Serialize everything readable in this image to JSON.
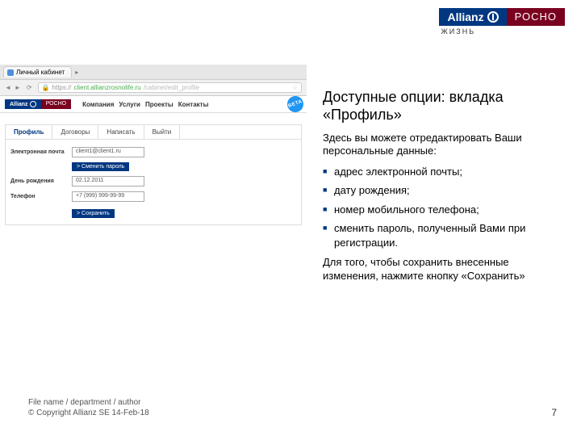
{
  "brand": {
    "allianz": "Allianz",
    "rosno": "РОСНО",
    "sub": "жизнь"
  },
  "browser": {
    "tab_title": "Личный кабинет",
    "url_host": "client.allianzrosnolife.ru",
    "url_path": "/cabinet/edit_profile"
  },
  "site": {
    "nav": [
      "Компания",
      "Услуги",
      "Проекты",
      "Контакты"
    ],
    "beta": "BETA",
    "tabs": [
      "Профиль",
      "Договоры",
      "Написать",
      "Выйти"
    ],
    "form": {
      "email_label": "Электронная почта",
      "email_value": "client1@client1.ru",
      "change_pw": "> Сменить пароль",
      "dob_label": "День рождения",
      "dob_value": "02.12.2011",
      "phone_label": "Телефон",
      "phone_value": "+7 (999) 999-99-99",
      "save": "> Сохранить"
    }
  },
  "right": {
    "title": "Доступные опции: вкладка «Профиль»",
    "intro": "Здесь вы можете отредактировать Ваши персональные данные:",
    "bullets": [
      "адрес электронной почты;",
      "дату рождения;",
      "номер мобильного телефона;",
      "сменить пароль, полученный Вами при регистрации."
    ],
    "outro": "Для того, чтобы сохранить внесенные изменения, нажмите кнопку «Сохранить»"
  },
  "footer": {
    "line1": "File name / department / author",
    "line2": "© Copyright Allianz SE 14-Feb-18"
  },
  "page": "7"
}
